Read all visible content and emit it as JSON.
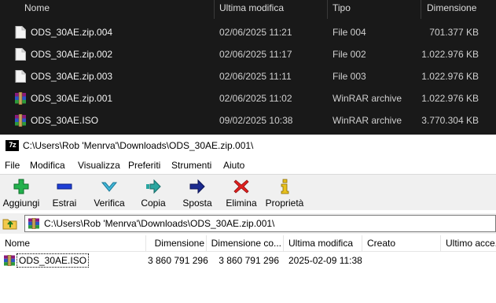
{
  "explorer": {
    "columns": {
      "name": "Nome",
      "modified": "Ultima modifica",
      "type": "Tipo",
      "size": "Dimensione"
    },
    "files": [
      {
        "name": "ODS_30AE.zip.004",
        "modified": "02/06/2025 11:21",
        "type": "File 004",
        "size": "701.377 KB",
        "icon": "blank-file-icon"
      },
      {
        "name": "ODS_30AE.zip.002",
        "modified": "02/06/2025 11:17",
        "type": "File 002",
        "size": "1.022.976 KB",
        "icon": "blank-file-icon"
      },
      {
        "name": "ODS_30AE.zip.003",
        "modified": "02/06/2025 11:11",
        "type": "File 003",
        "size": "1.022.976 KB",
        "icon": "blank-file-icon"
      },
      {
        "name": "ODS_30AE.zip.001",
        "modified": "02/06/2025 11:02",
        "type": "WinRAR archive",
        "size": "1.022.976 KB",
        "icon": "winrar-icon"
      },
      {
        "name": "ODS_30AE.ISO",
        "modified": "09/02/2025 10:38",
        "type": "WinRAR archive",
        "size": "3.770.304 KB",
        "icon": "winrar-icon"
      }
    ]
  },
  "sevenzip": {
    "logo_text": "7z",
    "title": "C:\\Users\\Rob 'Menrva'\\Downloads\\ODS_30AE.zip.001\\",
    "menu": [
      "File",
      "Modifica",
      "Visualizza",
      "Preferiti",
      "Strumenti",
      "Aiuto"
    ],
    "toolbar": {
      "add": "Aggiungi",
      "extract": "Estrai",
      "test": "Verifica",
      "copy": "Copia",
      "move": "Sposta",
      "delete": "Elimina",
      "info": "Proprietà"
    },
    "address": "C:\\Users\\Rob 'Menrva'\\Downloads\\ODS_30AE.zip.001\\",
    "list": {
      "columns": {
        "name": "Nome",
        "size": "Dimensione",
        "packed": "Dimensione co...",
        "modified": "Ultima modifica",
        "created": "Creato",
        "accessed": "Ultimo acce..."
      },
      "rows": [
        {
          "name": "ODS_30AE.ISO",
          "size": "3 860 791 296",
          "packed": "3 860 791 296",
          "modified": "2025-02-09 11:38"
        }
      ]
    },
    "colors": {
      "add": "#22b14c",
      "extract": "#1f3fd6",
      "test": "#41b7d8",
      "copy": "#2aa6a0",
      "move": "#1b2a8f",
      "delete": "#e0201f",
      "info": "#e8c21e"
    }
  }
}
